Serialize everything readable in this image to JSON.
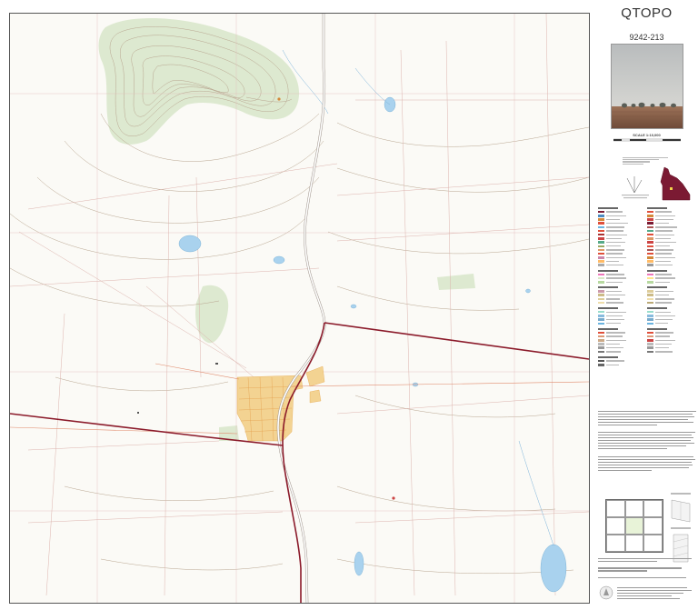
{
  "map": {
    "title": "QTOPO",
    "sheet_number": "9242-213",
    "scale": "SCALE 1:10,000",
    "colors": {
      "boundary": "#8b1a2a",
      "road": "#d84a30",
      "grid": "#d9a8a8",
      "contour": "#b7a38f",
      "water": "#8cc4e8",
      "vegetation": "#d5e6c2",
      "urban": "#f3c978"
    },
    "icons": [
      "legend-swatch-icon",
      "queensland-locator-icon",
      "cover-photo"
    ]
  }
}
